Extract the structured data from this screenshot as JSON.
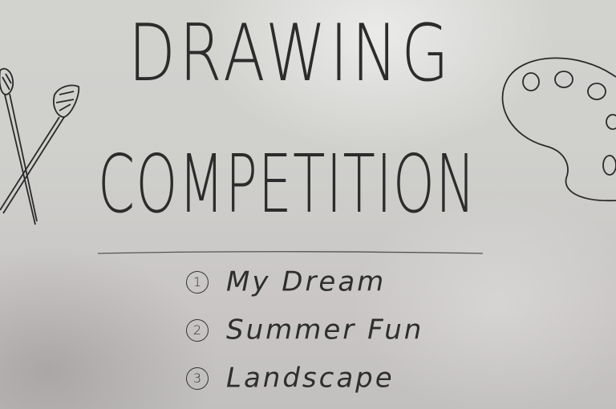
{
  "board": {
    "title_line1": "DRAWING",
    "title_line2": "COMPETITION",
    "topics": [
      {
        "number": "1",
        "label": "My Dream"
      },
      {
        "number": "2",
        "label": "Summer Fun"
      },
      {
        "number": "3",
        "label": "Landscape"
      }
    ]
  },
  "icons": [
    "paintbrush-icon",
    "palette-icon"
  ],
  "colors": {
    "marker": "#2c2c2c",
    "board": "#cfcfcc"
  }
}
